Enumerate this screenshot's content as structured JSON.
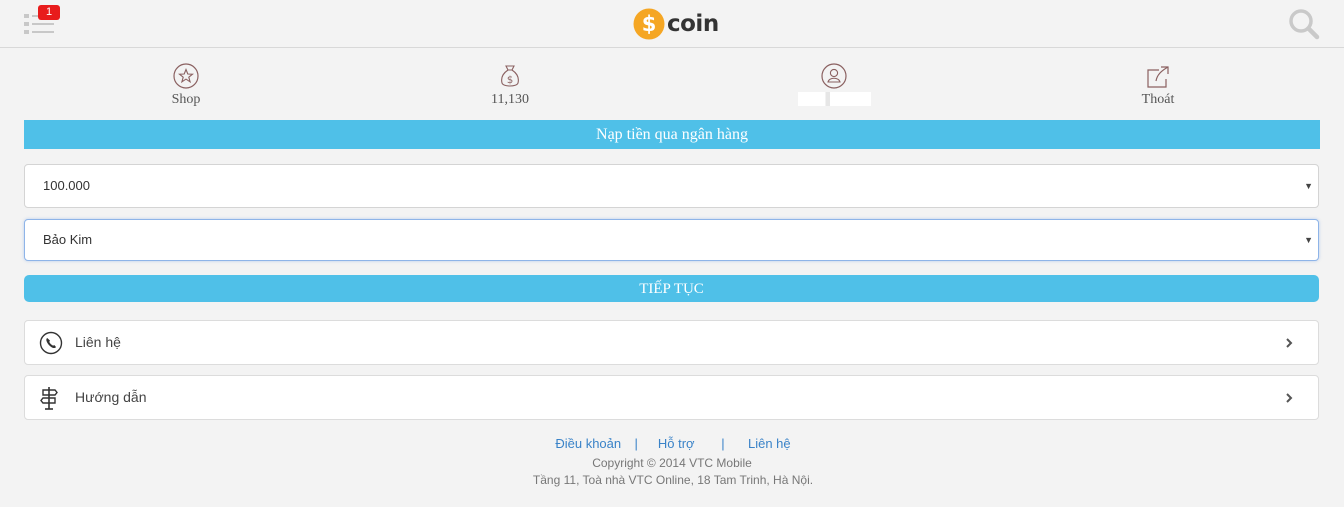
{
  "header": {
    "menu_icon": "menu-list-icon",
    "notification_count": "1",
    "logo_symbol": "$",
    "logo_text": "coin",
    "search_icon": "search-icon"
  },
  "nav": {
    "items": [
      {
        "icon": "star-circle-icon",
        "label": "Shop"
      },
      {
        "icon": "money-bag-icon",
        "label": "11,130"
      },
      {
        "icon": "user-circle-icon",
        "label": "",
        "label_obscured": true
      },
      {
        "icon": "logout-share-icon",
        "label": "Thoát"
      }
    ]
  },
  "form": {
    "title": "Nạp tiền qua ngân hàng",
    "amount_value": "100.000",
    "bank_value": "Bảo Kim",
    "caret": "▼",
    "submit_label": "TIẾP TỤC"
  },
  "links": {
    "items": [
      {
        "icon": "phone-icon",
        "label": "Liên hệ"
      },
      {
        "icon": "signpost-icon",
        "label": "Hướng dẫn"
      }
    ]
  },
  "footer": {
    "link_terms": "Điều khoản",
    "link_support": "Hỗ trợ",
    "link_contact": "Liên hệ",
    "separator": "|",
    "copyright": "Copyright © 2014 VTC Mobile",
    "address": "Tầng 11, Toà nhà VTC Online, 18 Tam Trinh, Hà Nội."
  },
  "colors": {
    "accent": "#4fc0e8",
    "badge": "#e81c1c",
    "logo_coin": "#f5a623",
    "link": "#3a83c8",
    "background": "#f3f3f3"
  }
}
